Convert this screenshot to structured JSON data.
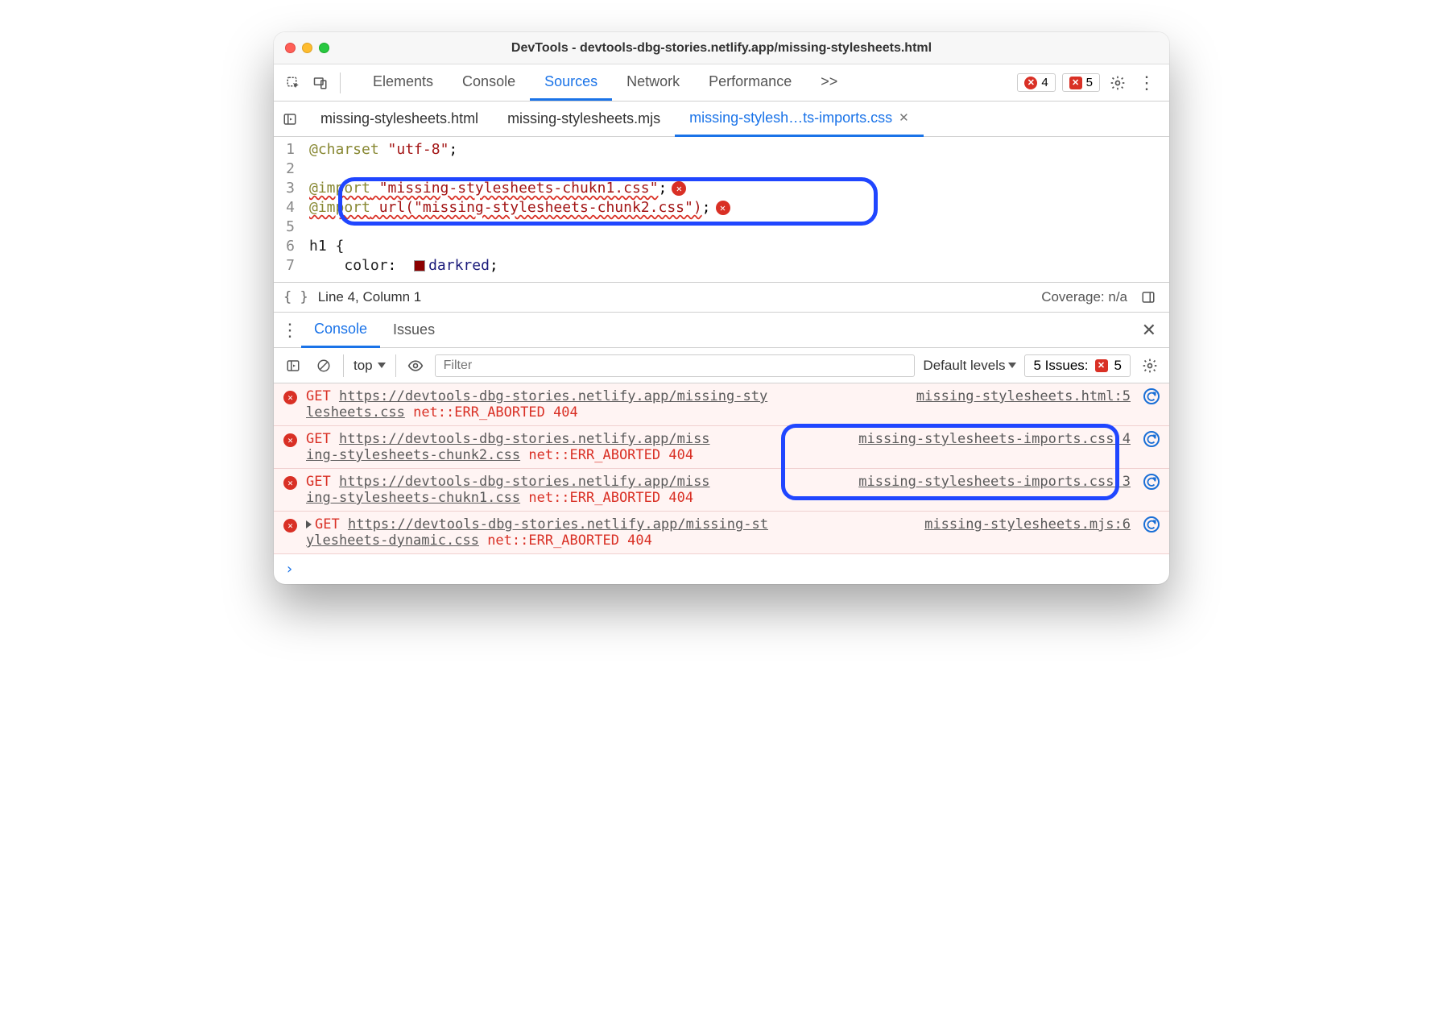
{
  "window": {
    "title": "DevTools - devtools-dbg-stories.netlify.app/missing-stylesheets.html"
  },
  "toolbar": {
    "panels": [
      "Elements",
      "Console",
      "Sources",
      "Network",
      "Performance"
    ],
    "active_panel": "Sources",
    "overflow": ">>",
    "errors_count": "4",
    "issues_count": "5"
  },
  "file_tabs": {
    "tabs": [
      {
        "label": "missing-stylesheets.html",
        "active": false
      },
      {
        "label": "missing-stylesheets.mjs",
        "active": false
      },
      {
        "label": "missing-stylesh…ts-imports.css",
        "active": true
      }
    ]
  },
  "editor": {
    "lines": [
      {
        "n": "1",
        "type": "charset",
        "raw": "@charset \"utf-8\";"
      },
      {
        "n": "2",
        "type": "blank"
      },
      {
        "n": "3",
        "type": "import",
        "kw": "@import",
        "arg": " \"missing-stylesheets-chukn1.css\"",
        "tail": ";",
        "error": true
      },
      {
        "n": "4",
        "type": "import",
        "kw": "@import",
        "arg": " url(\"missing-stylesheets-chunk2.css\")",
        "tail": ";",
        "error": true
      },
      {
        "n": "5",
        "type": "blank"
      },
      {
        "n": "6",
        "type": "sel",
        "raw": "h1 {"
      },
      {
        "n": "7",
        "type": "prop",
        "indent": "    ",
        "prop": "color",
        "val": "darkred",
        "swatch": true
      }
    ]
  },
  "status": {
    "cursor": "Line 4, Column 1",
    "coverage": "Coverage: n/a"
  },
  "drawer": {
    "tabs": [
      "Console",
      "Issues"
    ],
    "active": "Console"
  },
  "console_toolbar": {
    "context": "top",
    "filter_placeholder": "Filter",
    "levels": "Default levels",
    "issues_label": "5 Issues:",
    "issues_num": "5"
  },
  "console_rows": [
    {
      "method": "GET",
      "url_a": "https://devtools-dbg-stories.netlify.app/missing-sty",
      "url_b": "lesheets.css",
      "err": "net::ERR_ABORTED 404",
      "src": "missing-stylesheets.html:5"
    },
    {
      "method": "GET",
      "url_a": "https://devtools-dbg-stories.netlify.app/miss",
      "url_b": "ing-stylesheets-chunk2.css",
      "err": "net::ERR_ABORTED 404",
      "src": "missing-stylesheets-imports.css:4"
    },
    {
      "method": "GET",
      "url_a": "https://devtools-dbg-stories.netlify.app/miss",
      "url_b": "ing-stylesheets-chukn1.css",
      "err": "net::ERR_ABORTED 404",
      "src": "missing-stylesheets-imports.css:3"
    },
    {
      "method": "GET",
      "url_a": "https://devtools-dbg-stories.netlify.app/missing-st",
      "url_b": "ylesheets-dynamic.css",
      "err": "net::ERR_ABORTED 404",
      "src": "missing-stylesheets.mjs:6",
      "caret": true
    }
  ],
  "prompt": "›"
}
